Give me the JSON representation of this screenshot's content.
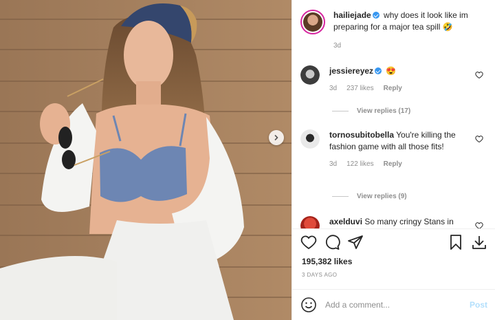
{
  "post": {
    "author": "hailiejade",
    "caption": "why does it look like im preparing for a major tea spill 🤣",
    "caption_age": "3d",
    "likes": "195,382 likes",
    "date": "3 DAYS AGO"
  },
  "comments": [
    {
      "username": "jessiereyez",
      "text": "😍",
      "age": "3d",
      "likes": "237 likes",
      "reply": "Reply",
      "view_replies": "View replies (17)"
    },
    {
      "username": "tornosubitobella",
      "text": "You're killing the fashion game with all those fits!",
      "age": "3d",
      "likes": "122 likes",
      "reply": "Reply",
      "view_replies": "View replies (9)"
    },
    {
      "username": "axelduvi",
      "text": "So many cringy Stans in"
    }
  ],
  "add_comment": {
    "placeholder": "Add a comment...",
    "post_label": "Post"
  },
  "icons": {
    "next": "chevron-right-icon",
    "like": "heart-icon",
    "comment": "comment-bubble-icon",
    "share": "paper-plane-icon",
    "save": "bookmark-icon",
    "download": "download-icon",
    "emoji": "smiley-icon"
  },
  "colors": {
    "verified": "#3897f0",
    "muted": "#8e8e8e",
    "post_button": "#b2dffc",
    "story_ring": "#d6249f"
  }
}
